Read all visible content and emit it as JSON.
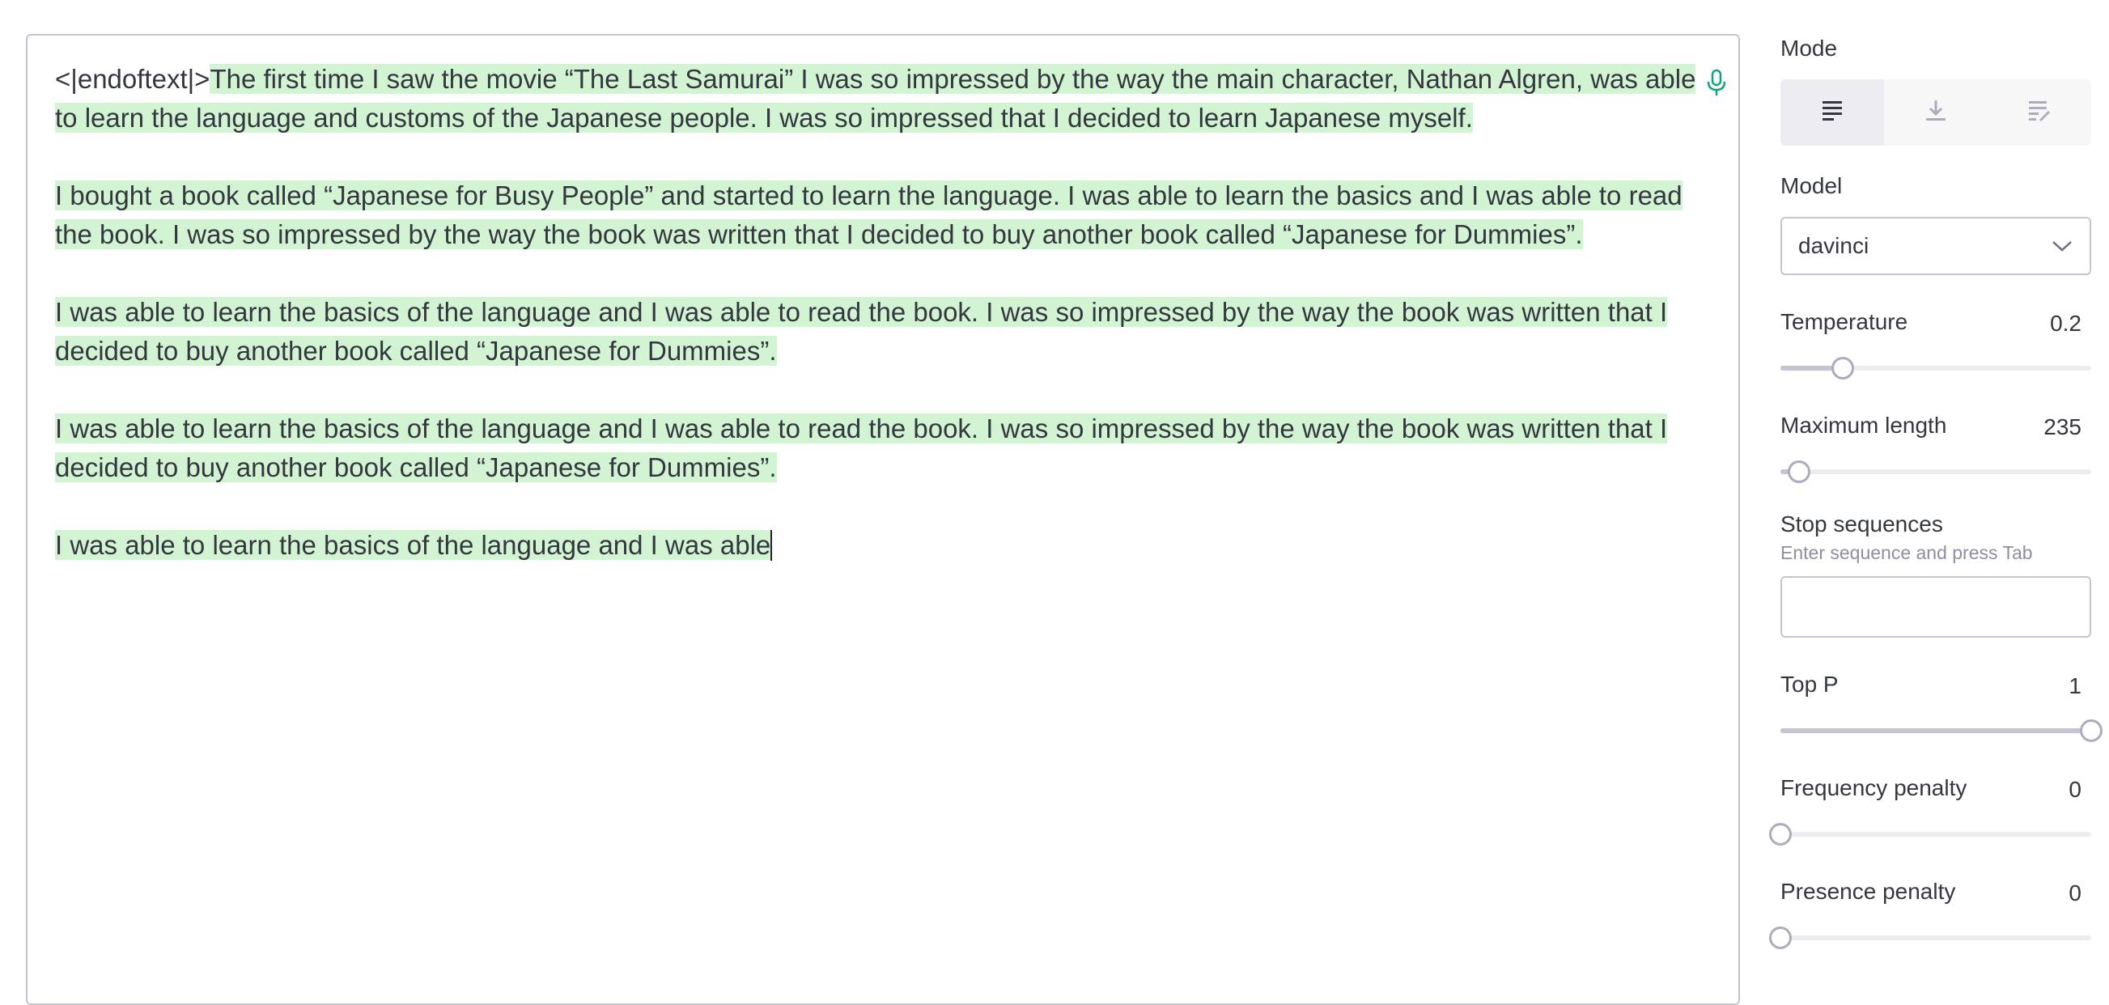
{
  "editor": {
    "prompt_prefix": "<|endoftext|>",
    "paragraphs": [
      "The first time I saw the movie “The Last Samurai” I was so impressed by the way the main character, Nathan Algren, was able to learn the language and customs of the Japanese people. I was so impressed that I decided to learn Japanese myself.",
      "I bought a book called “Japanese for Busy People” and started to learn the language. I was able to learn the basics and I was able to read the book. I was so impressed by the way the book was written that I decided to buy another book called “Japanese for Dummies”.",
      "I was able to learn the basics of the language and I was able to read the book. I was so impressed by the way the book was written that I decided to buy another book called “Japanese for Dummies”.",
      "I was able to learn the basics of the language and I was able to read the book. I was so impressed by the way the book was written that I decided to buy another book called “Japanese for Dummies”.",
      "I was able to learn the basics of the language and I was able"
    ],
    "mic_icon": "microphone-icon",
    "highlight_color": "#d2f4d3"
  },
  "settings": {
    "mode": {
      "label": "Mode",
      "options": [
        "complete",
        "insert",
        "edit"
      ],
      "icons": [
        "complete-mode-icon",
        "insert-mode-icon",
        "edit-mode-icon"
      ],
      "selected": 0
    },
    "model": {
      "label": "Model",
      "value": "davinci"
    },
    "temperature": {
      "label": "Temperature",
      "value": "0.2",
      "fraction": 0.2
    },
    "max_length": {
      "label": "Maximum length",
      "value": "235",
      "fraction": 0.06
    },
    "stop_sequences": {
      "label": "Stop sequences",
      "hint": "Enter sequence and press Tab",
      "value": ""
    },
    "top_p": {
      "label": "Top P",
      "value": "1",
      "fraction": 1.0
    },
    "frequency_penalty": {
      "label": "Frequency penalty",
      "value": "0",
      "fraction": 0.0
    },
    "presence_penalty": {
      "label": "Presence penalty",
      "value": "0",
      "fraction": 0.0
    }
  }
}
